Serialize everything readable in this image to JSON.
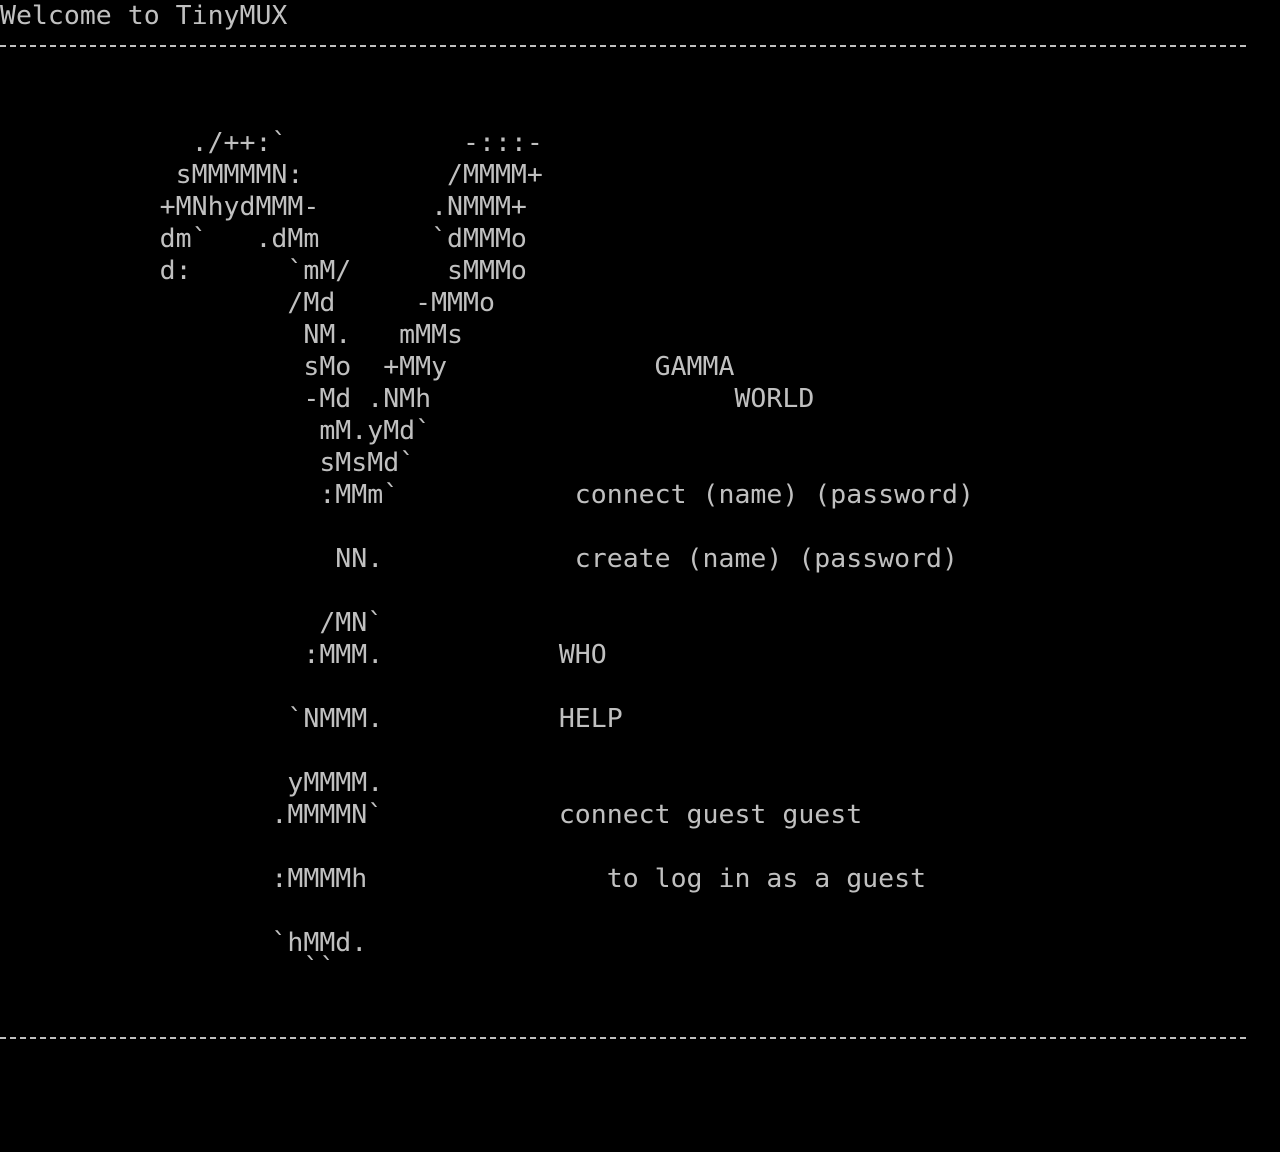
{
  "terminal": {
    "title": "Welcome to TinyMUX",
    "separator": "--------------------------------------------------------------------------------",
    "art_lines": [
      "            ./++:`           -:::-",
      "           sMMMMMN:         /MMMM+",
      "          +MNhydMMM-       .NMMM+",
      "          dm`   .dMm       `dMMMo",
      "          d:      `mM/      sMMMo",
      "                  /Md     -MMMo",
      "                   NM.   mMMs",
      "                   sMo  +MMy             GAMMA",
      "                   -Md .NMh                   WORLD",
      "                    mM.yMd`",
      "                    sMsMd`",
      "                    :MMm`           connect (name) (password)",
      "",
      "                     NN.            create (name) (password)",
      "",
      "                    /MN`",
      "                   :MMM.           WHO",
      "",
      "                  `NMMM.           HELP",
      "",
      "                  yMMMM.",
      "                 .MMMMN`           connect guest guest",
      "",
      "                 :MMMMh               to log in as a guest",
      "",
      "                 `hMMd.",
      "                   ``"
    ]
  }
}
